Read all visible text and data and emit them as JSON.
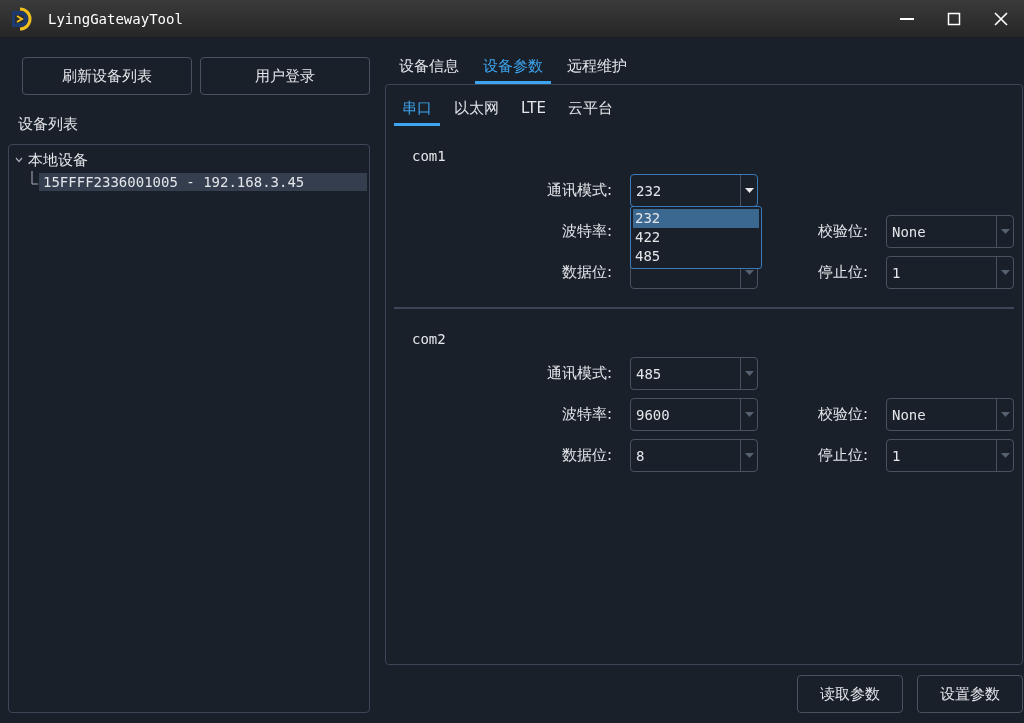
{
  "window": {
    "title": "LyingGatewayTool"
  },
  "left_buttons": [
    "刷新设备列表",
    "用户登录"
  ],
  "device_list": {
    "title": "设备列表",
    "tree": [
      {
        "label": "本地设备",
        "expanded": true,
        "children": [
          {
            "label": "15FFFF2336001005 - 192.168.3.45",
            "selected": true
          }
        ]
      }
    ]
  },
  "tabs": [
    {
      "label": "设备信息",
      "selected": false
    },
    {
      "label": "设备参数",
      "selected": true
    },
    {
      "label": "远程维护",
      "selected": false
    }
  ],
  "subtabs": [
    {
      "label": "串口",
      "selected": true
    },
    {
      "label": "以太网",
      "selected": false
    },
    {
      "label": "LTE",
      "selected": false
    },
    {
      "label": "云平台",
      "selected": false
    }
  ],
  "ports": [
    {
      "name": "com1",
      "fields": [
        {
          "label": "通讯模式:",
          "value": "232",
          "open": true,
          "options": [
            {
              "label": "232",
              "selected": true
            },
            {
              "label": "422",
              "selected": false
            },
            {
              "label": "485",
              "selected": false
            }
          ]
        },
        {
          "label": "波特率:"
        },
        {
          "label": "校验位:",
          "value": "None"
        },
        {
          "label": "数据位:"
        },
        {
          "label": "停止位:",
          "value": "1"
        }
      ]
    },
    {
      "name": "com2",
      "fields": [
        {
          "label": "通讯模式:",
          "value": "485"
        },
        {
          "label": "波特率:",
          "value": "9600"
        },
        {
          "label": "校验位:",
          "value": "None"
        },
        {
          "label": "数据位:",
          "value": "8"
        },
        {
          "label": "停止位:",
          "value": "1"
        }
      ]
    }
  ],
  "footer_buttons": [
    "读取参数",
    "设置参数"
  ]
}
